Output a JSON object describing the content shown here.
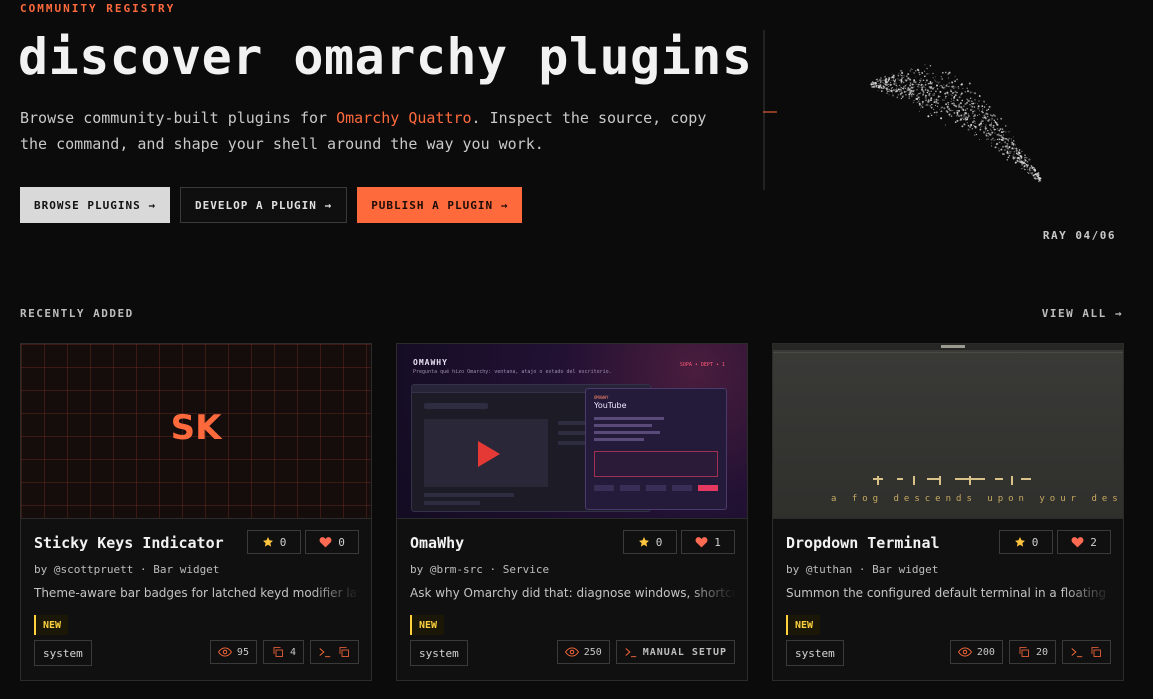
{
  "hero": {
    "eyebrow": "COMMUNITY REGISTRY",
    "title": "discover omarchy plugins",
    "desc_before": "Browse community-built plugins for ",
    "desc_link": "Omarchy Quattro",
    "desc_after": ". Inspect the source, copy the command, and shape your shell around the way you work.",
    "buttons": {
      "browse": "BROWSE PLUGINS →",
      "develop": "DEVELOP A PLUGIN →",
      "publish": "PUBLISH A PLUGIN →"
    },
    "art_caption": "RAY 04/06"
  },
  "section": {
    "label": "RECENTLY ADDED",
    "view_all": "VIEW ALL →"
  },
  "cards": [
    {
      "thumb_text": "SK",
      "title": "Sticky Keys Indicator",
      "stars": "0",
      "likes": "0",
      "byline": "by @scottpruett · Bar widget",
      "description": "Theme-aware bar badges for latched keyd modifier layers",
      "badge": "NEW",
      "tag": "system",
      "views": "95",
      "copies": "4"
    },
    {
      "thumb_brand": "OMAWHY",
      "thumb_sub": "Pregunta qué hizo Omarchy: ventana, atajo o estado del escritorio.",
      "thumb_tag": "SOPA • DEPT • 1",
      "thumb_win_label": "OMAWHY",
      "thumb_win_title": "YouTube",
      "title": "OmaWhy",
      "stars": "0",
      "likes": "1",
      "byline": "by @brm-src · Service",
      "description": "Ask why Omarchy did that: diagnose windows, shortcuts and state",
      "badge": "NEW",
      "tag": "system",
      "views": "250",
      "manual": "MANUAL SETUP"
    },
    {
      "thumb_echo": "a fog descends upon your desktop",
      "title": "Dropdown Terminal",
      "stars": "0",
      "likes": "2",
      "byline": "by @tuthan · Bar widget",
      "description": "Summon the configured default terminal in a floating special workspace",
      "badge": "NEW",
      "tag": "system",
      "views": "200",
      "copies": "20"
    }
  ],
  "colors": {
    "accent": "#ff6a3d",
    "badge": "#ffd23d",
    "star": "#ffc53d",
    "heart": "#ff6a52"
  },
  "icons": [
    "star-icon",
    "heart-icon",
    "eye-icon",
    "copy-icon",
    "terminal-icon",
    "arrow-right-icon"
  ]
}
